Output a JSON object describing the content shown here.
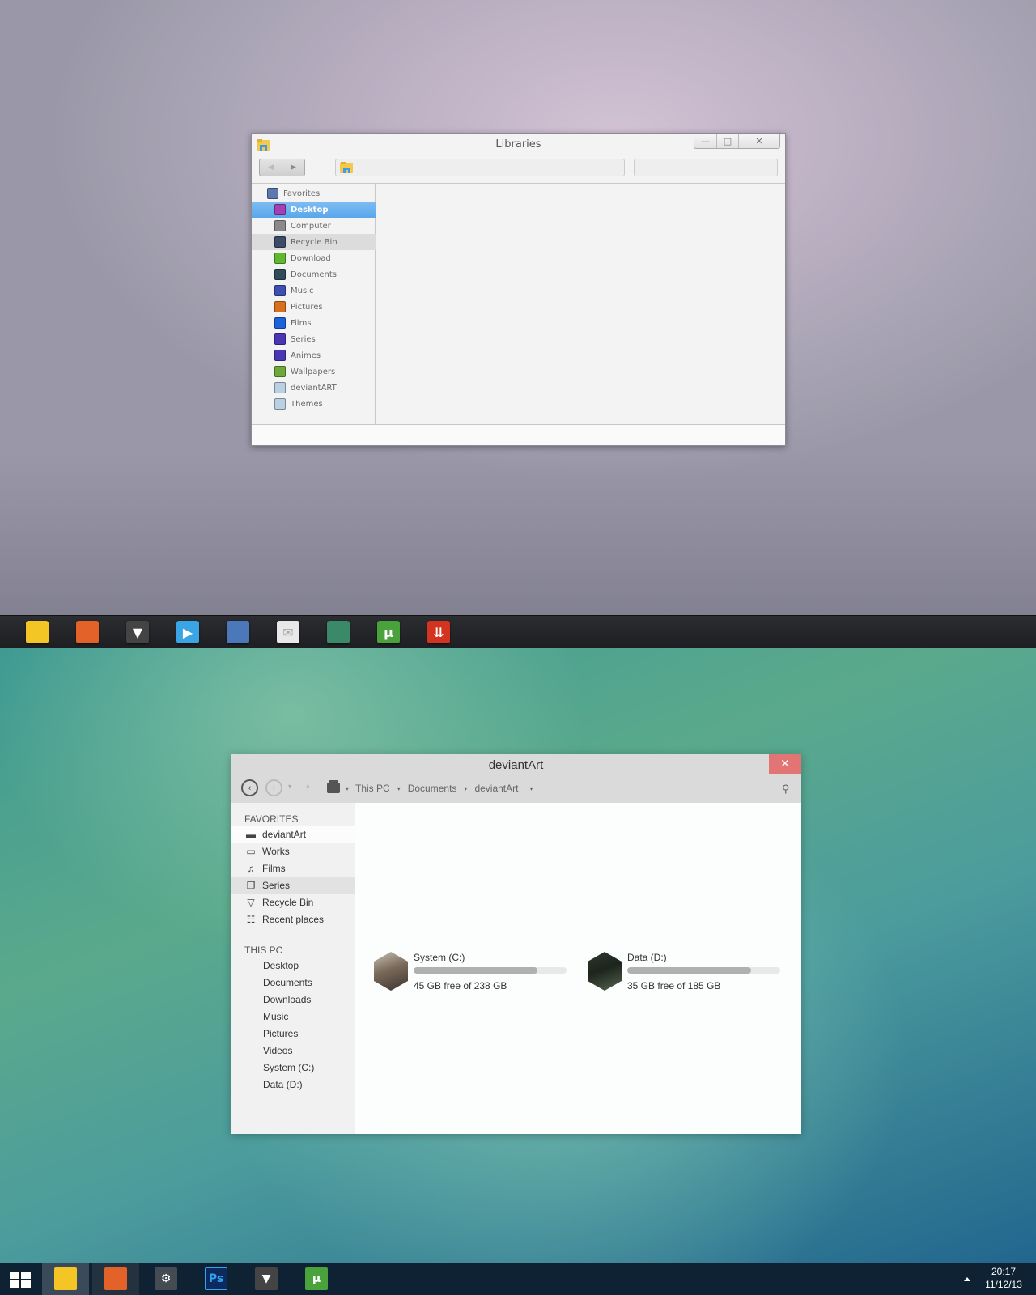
{
  "top_window": {
    "title": "Libraries",
    "caption": {
      "minimize": "—",
      "maximize": "□",
      "close": "✕"
    },
    "nav": {
      "back": "◀",
      "forward": "▶"
    },
    "address_value": "",
    "search_placeholder": "",
    "sidebar": [
      {
        "label": "Favorites",
        "icon": "favorites-house-icon",
        "color": "#5b78b0",
        "level": "fav"
      },
      {
        "label": "Desktop",
        "icon": "desktop-icon",
        "color": "#a43fb6",
        "level": "sub",
        "state": "selected"
      },
      {
        "label": "Computer",
        "icon": "computer-icon",
        "color": "#8a8a8a",
        "level": "sub"
      },
      {
        "label": "Recycle Bin",
        "icon": "recycle-bin-icon",
        "color": "#3a4c66",
        "level": "sub",
        "state": "hover"
      },
      {
        "label": "Download",
        "icon": "download-icon",
        "color": "#5fb82d",
        "level": "sub"
      },
      {
        "label": "Documents",
        "icon": "documents-icon",
        "color": "#2f4c57",
        "level": "sub"
      },
      {
        "label": "Music",
        "icon": "music-icon",
        "color": "#3d4fb0",
        "level": "sub"
      },
      {
        "label": "Pictures",
        "icon": "pictures-icon",
        "color": "#d77120",
        "level": "sub"
      },
      {
        "label": "Films",
        "icon": "films-icon",
        "color": "#1c62d8",
        "level": "sub"
      },
      {
        "label": "Series",
        "icon": "series-icon",
        "color": "#4a35b5",
        "level": "sub"
      },
      {
        "label": "Animes",
        "icon": "animes-icon",
        "color": "#4a35b5",
        "level": "sub"
      },
      {
        "label": "Wallpapers",
        "icon": "wallpapers-icon",
        "color": "#6ea83a",
        "level": "sub"
      },
      {
        "label": "deviantART",
        "icon": "folder-icon",
        "color": "#b9d0e2",
        "level": "sub"
      },
      {
        "label": "Themes",
        "icon": "folder-icon",
        "color": "#b9d0e2",
        "level": "sub"
      }
    ]
  },
  "dock": [
    {
      "name": "file-explorer",
      "color": "#f3c626",
      "glyph": ""
    },
    {
      "name": "firefox",
      "color": "#e2622a",
      "glyph": ""
    },
    {
      "name": "foobar",
      "color": "#444444",
      "glyph": "▼"
    },
    {
      "name": "media-player",
      "color": "#3aa4e4",
      "glyph": "▶"
    },
    {
      "name": "vlc-like-app",
      "color": "#4b78b8",
      "glyph": ""
    },
    {
      "name": "mail",
      "color": "#e8e8e8",
      "glyph": "✉"
    },
    {
      "name": "jdownloader",
      "color": "#3a8a6a",
      "glyph": ""
    },
    {
      "name": "utorrent",
      "color": "#4aa23c",
      "glyph": "μ"
    },
    {
      "name": "downloader",
      "color": "#d23420",
      "glyph": "⇊"
    }
  ],
  "bottom_window": {
    "title": "deviantArt",
    "close": "✕",
    "nav": {
      "back": "‹",
      "forward": "›",
      "recent": "▾",
      "up": "˄"
    },
    "breadcrumb": [
      "This PC",
      "Documents",
      "deviantArt"
    ],
    "breadcrumb_arrow": "▾",
    "search_icon": "⚲",
    "favorites_header": "FAVORITES",
    "favorites": [
      {
        "label": "deviantArt",
        "icon": "folder-icon",
        "glyph": "▬",
        "state": "active"
      },
      {
        "label": "Works",
        "icon": "works-icon",
        "glyph": "▭"
      },
      {
        "label": "Films",
        "icon": "music-note-icon",
        "glyph": "♫"
      },
      {
        "label": "Series",
        "icon": "copy-icon",
        "glyph": "❐",
        "state": "hover"
      },
      {
        "label": "Recycle Bin",
        "icon": "recycle-bin-icon",
        "glyph": "▽"
      },
      {
        "label": "Recent places",
        "icon": "recent-places-icon",
        "glyph": "☷"
      }
    ],
    "this_pc_header": "THIS PC",
    "this_pc": [
      "Desktop",
      "Documents",
      "Downloads",
      "Music",
      "Pictures",
      "Videos",
      "System (C:)",
      "Data (D:)"
    ],
    "drives": [
      {
        "name": "System (C:)",
        "info": "45 GB free of 238 GB",
        "used_fraction": 0.81,
        "thumb_colors": [
          "#c8c2b6",
          "#3b3430",
          "#7a6a5a"
        ]
      },
      {
        "name": "Data (D:)",
        "info": "35 GB free of 185 GB",
        "used_fraction": 0.81,
        "thumb_colors": [
          "#2f3a2e",
          "#55634f",
          "#1c241c"
        ]
      }
    ]
  },
  "taskbar": {
    "apps": [
      {
        "name": "file-explorer",
        "color": "#f3c626",
        "glyph": "",
        "state": "active"
      },
      {
        "name": "firefox",
        "color": "#e2622a",
        "glyph": "",
        "state": "open"
      },
      {
        "name": "steam",
        "color": "#444b52",
        "glyph": "⚙"
      },
      {
        "name": "photoshop",
        "color": "#0d2a5e",
        "glyph": "Ps"
      },
      {
        "name": "foobar",
        "color": "#444444",
        "glyph": "▼"
      },
      {
        "name": "utorrent",
        "color": "#4aa23c",
        "glyph": "μ"
      }
    ],
    "time": "20:17",
    "date": "11/12/13"
  }
}
